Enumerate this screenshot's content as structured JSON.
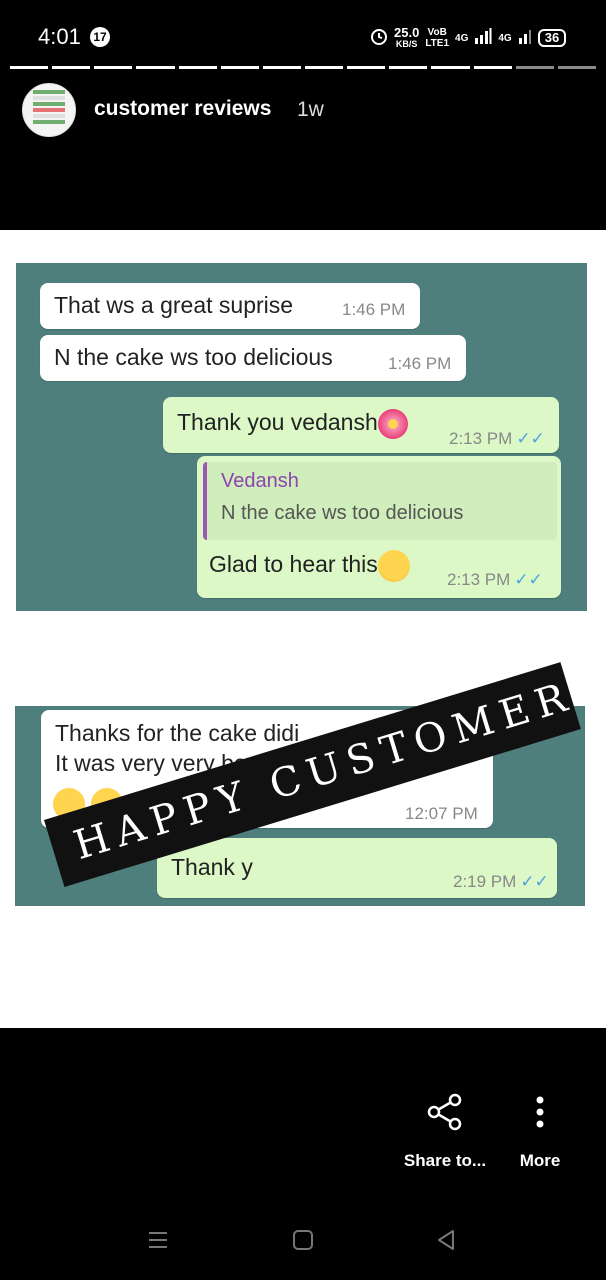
{
  "status_bar": {
    "time": "4:01",
    "notification_count": "17",
    "speed_value": "25.0",
    "speed_unit": "KB/S",
    "volte_top": "VoB",
    "volte_bottom": "LTE1",
    "net1": "4G",
    "net2": "4G",
    "battery": "36"
  },
  "story": {
    "title": "customer reviews",
    "age": "1w",
    "progress_total_segments": 14,
    "progress_viewed_segments": 12
  },
  "chat1": {
    "msg1": {
      "text": "That ws a great suprise",
      "time": "1:46 PM"
    },
    "msg2": {
      "text": "N the cake ws too delicious",
      "time": "1:46 PM"
    },
    "msg3": {
      "text": "Thank you vedansh",
      "time": "2:13 PM"
    },
    "reply": {
      "quote_name": "Vedansh",
      "quote_text": "N the cake ws too delicious",
      "text": "Glad to hear this",
      "time": "2:13 PM"
    }
  },
  "chat2": {
    "msg1": {
      "line1": "Thanks for the cake didi",
      "line2": "It was very very beautiful and tasty",
      "time": "12:07 PM"
    },
    "msg2": {
      "text": "Thank y",
      "time": "2:19 PM"
    }
  },
  "banner": {
    "text": "HAPPY CUSTOMERS"
  },
  "actions": {
    "share_label": "Share to...",
    "more_label": "More"
  },
  "colors": {
    "chat_bg": "#4e7f7c",
    "outgoing_bubble": "#dcf8c6",
    "incoming_bubble": "#ffffff",
    "read_ticks": "#4fa3e0",
    "quote_name": "#8e44ad"
  }
}
